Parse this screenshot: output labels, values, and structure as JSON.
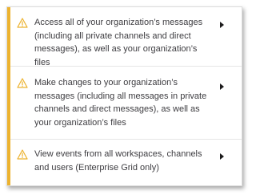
{
  "colors": {
    "accent": "#ecb22e",
    "warning_icon": "#ecb22e",
    "text": "#3d3c40",
    "caret": "#1d1c1d"
  },
  "permissions": [
    {
      "icon": "warning-icon",
      "text": "Access all of your organization’s messages (including all private channels and direct messages), as well as your organization’s files"
    },
    {
      "icon": "warning-icon",
      "text": "Make changes to your organization’s messages (including all messages in private channels and direct messages), as well as your organization’s files"
    },
    {
      "icon": "warning-icon",
      "text": "View events from all workspaces, channels and users (Enterprise Grid only)"
    }
  ]
}
